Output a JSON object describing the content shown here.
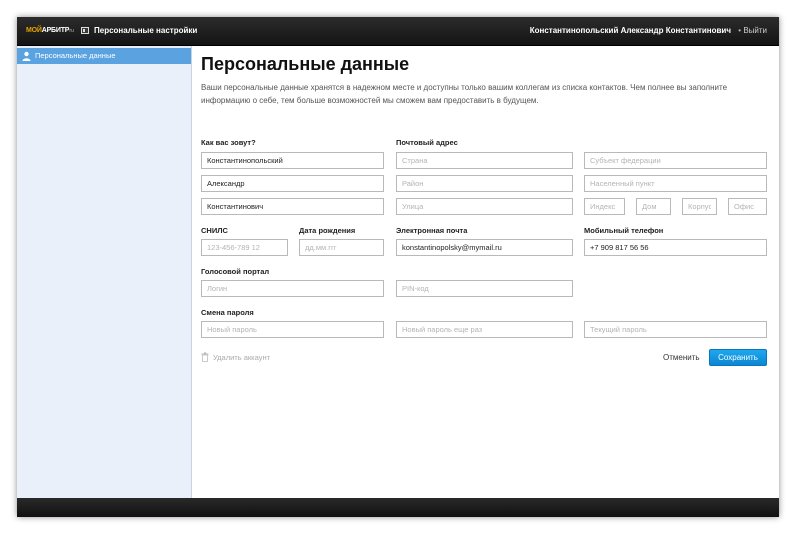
{
  "header": {
    "logo_part1": "МОЙ",
    "logo_part2": "АРБИТР",
    "logo_part3": "ru",
    "section_title": "Персональные настройки",
    "user_name": "Константинопольский Александр Константинович",
    "separator": "•",
    "logout": "Выйти"
  },
  "sidebar": {
    "items": [
      {
        "label": "Персональные данные",
        "icon": "person-icon",
        "active": true
      }
    ]
  },
  "main": {
    "title": "Персональные данные",
    "intro": "Ваши персональные данные хранятся в надежном месте и доступны только вашим коллегам из списка контактов. Чем полнее вы заполните информацию о себе, тем больше возможностей мы сможем вам предоставить в будущем."
  },
  "name_section": {
    "label": "Как вас зовут?",
    "last_name": "Константинопольский",
    "first_name": "Александр",
    "middle_name": "Константинович"
  },
  "address_section": {
    "label": "Почтовый адрес",
    "country_placeholder": "Страна",
    "region_placeholder": "Субъект федерации",
    "district_placeholder": "Район",
    "locality_placeholder": "Населенный пункт",
    "street_placeholder": "Улица",
    "index_placeholder": "Индекс",
    "house_placeholder": "Дом",
    "building_placeholder": "Корпус",
    "office_placeholder": "Офис"
  },
  "snils": {
    "label": "СНИЛС",
    "placeholder": "123-456-789 12"
  },
  "birthdate": {
    "label": "Дата рождения",
    "placeholder": "дд.мм.ггг"
  },
  "email": {
    "label": "Электронная почта",
    "value": "konstantinopolsky@mymail.ru"
  },
  "phone": {
    "label": "Мобильный телефон",
    "value": "+7 909 817 56 56"
  },
  "voice_portal": {
    "label": "Голосовой портал",
    "login_placeholder": "Логин",
    "pin_placeholder": "PIN-код"
  },
  "password": {
    "label": "Смена пароля",
    "new_placeholder": "Новый пароль",
    "repeat_placeholder": "Новый пароль еще раз",
    "current_placeholder": "Текущий пароль"
  },
  "actions": {
    "delete": "Удалить аккаунт",
    "cancel": "Отменить",
    "save": "Сохранить"
  },
  "colors": {
    "accent": "#1a9ee8",
    "sidebar_active": "#5aa3e0",
    "sidebar_bg": "#e9f0fa"
  }
}
